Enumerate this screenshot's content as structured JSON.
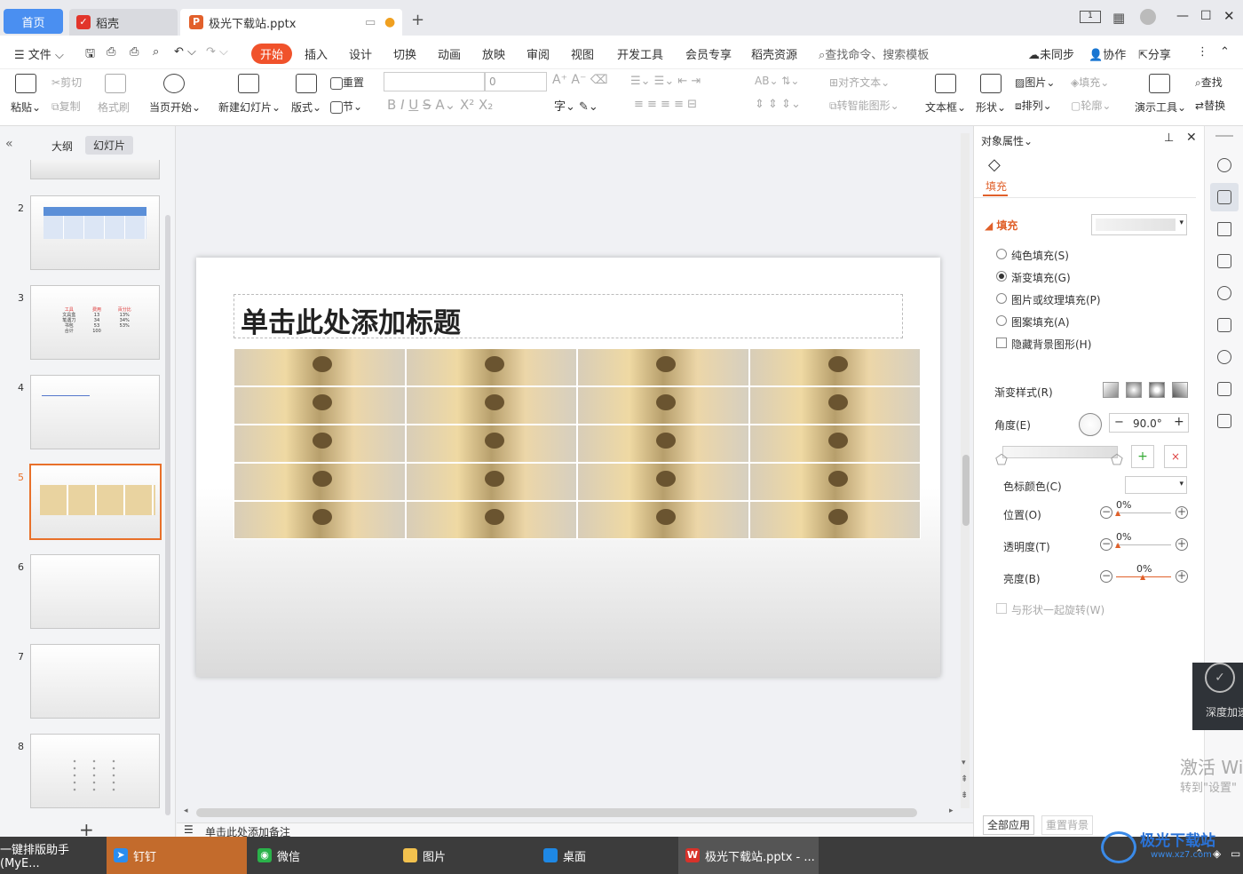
{
  "tabs": {
    "home": "首页",
    "daoke": "稻壳",
    "file": "极光下载站.pptx"
  },
  "menu": {
    "file": "文件",
    "items": [
      "开始",
      "插入",
      "设计",
      "切换",
      "动画",
      "放映",
      "审阅",
      "视图",
      "开发工具",
      "会员专享",
      "稻壳资源"
    ],
    "search": "查找命令、搜索模板",
    "unsync": "未同步",
    "collab": "协作",
    "share": "分享"
  },
  "ribbon": {
    "paste": "粘贴",
    "cut": "剪切",
    "copy": "复制",
    "format_painter": "格式刷",
    "play_current": "当页开始",
    "new_slide": "新建幻灯片",
    "layout": "版式",
    "section": "节",
    "reset": "重置",
    "font_size": "0",
    "align_text": "对齐文本",
    "smart_shape": "转智能图形",
    "textbox": "文本框",
    "shape": "形状",
    "picture": "图片",
    "fill": "填充",
    "arrange": "排列",
    "outline": "轮廓",
    "present_tools": "演示工具",
    "find": "查找",
    "replace": "替换"
  },
  "left": {
    "outline_tab": "大纲",
    "slides_tab": "幻灯片",
    "slide_numbers": [
      "2",
      "3",
      "4",
      "5",
      "6",
      "7",
      "8"
    ],
    "selected": "5",
    "table_thumb": {
      "headers": [
        "工具",
        "费用",
        "百分比"
      ],
      "rows": [
        [
          "文具盒",
          "13",
          "13%"
        ],
        [
          "笔遇刀",
          "34",
          "34%"
        ],
        [
          "书包",
          "53",
          "53%"
        ],
        [
          "合计",
          "100",
          ""
        ]
      ]
    }
  },
  "slide": {
    "title_placeholder": "单击此处添加标题",
    "grid_rows": 5,
    "grid_cols": 4
  },
  "notes_placeholder": "单击此处添加备注",
  "panel": {
    "header": "对象属性",
    "tab_fill": "填充",
    "section_fill": "填充",
    "options": [
      "纯色填充(S)",
      "渐变填充(G)",
      "图片或纹理填充(P)",
      "图案填充(A)"
    ],
    "selected_option": "渐变填充(G)",
    "hide_bg": "隐藏背景图形(H)",
    "gradient_style": "渐变样式(R)",
    "angle_label": "角度(E)",
    "angle_value": "90.0°",
    "stop_color": "色标颜色(C)",
    "position": "位置(O)",
    "transparency": "透明度(T)",
    "brightness": "亮度(B)",
    "position_value": "0%",
    "transparency_value": "0%",
    "brightness_value": "0%",
    "rotate_with_shape": "与形状一起旋转(W)",
    "apply_all": "全部应用",
    "reset_bg": "重置背景"
  },
  "overlay": {
    "speed": "深度加速",
    "activate_1": "激活 Wi",
    "activate_2": "转到\"设置\"",
    "watermark": "极光下载站",
    "watermark_url": "www.xz7.com"
  },
  "taskbar": {
    "items": [
      "一键排版助手(MyE...",
      "钉钉",
      "微信",
      "图片",
      "桌面",
      "极光下载站.pptx - ..."
    ]
  }
}
